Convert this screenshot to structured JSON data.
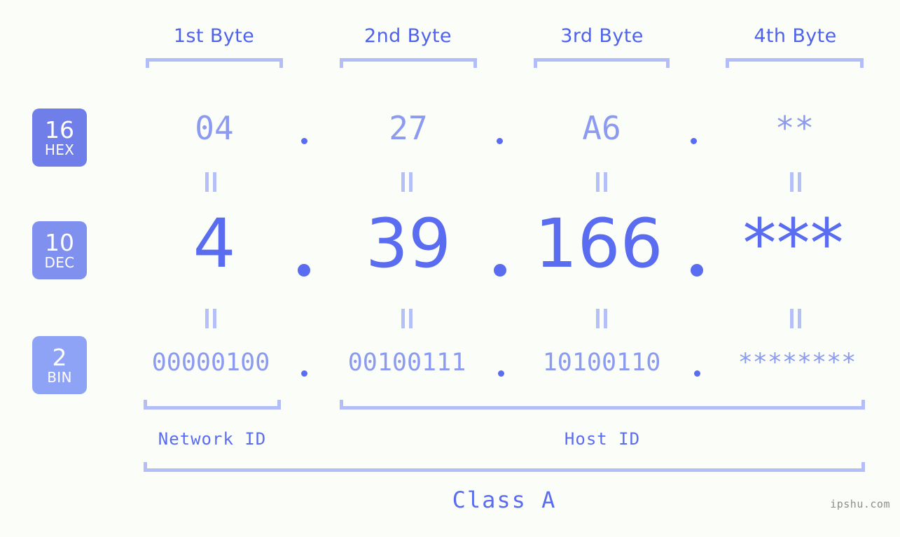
{
  "header": {
    "byte_labels": [
      "1st Byte",
      "2nd Byte",
      "3rd Byte",
      "4th Byte"
    ]
  },
  "bases": [
    {
      "number": "16",
      "name": "HEX",
      "color": "#6f7ee8"
    },
    {
      "number": "10",
      "name": "DEC",
      "color": "#8090ef"
    },
    {
      "number": "2",
      "name": "BIN",
      "color": "#8fa3f6"
    }
  ],
  "rows": {
    "hex": {
      "values": [
        "04",
        "27",
        "A6",
        "**"
      ],
      "separator": "."
    },
    "dec": {
      "values": [
        "4",
        "39",
        "166",
        "***"
      ],
      "separator": "."
    },
    "bin": {
      "values": [
        "00000100",
        "00100111",
        "10100110",
        "********"
      ],
      "separator": "."
    }
  },
  "connectors": {
    "equals_glyph": "||"
  },
  "footer": {
    "network_id_label": "Network ID",
    "host_id_label": "Host ID",
    "class_label": "Class A",
    "watermark": "ipshu.com"
  },
  "colors": {
    "background": "#fbfdf8",
    "accent_strong": "#5a6df0",
    "accent_mid": "#8c9bf0",
    "accent_light": "#b3bdf7",
    "byte_label": "#4f62ec",
    "watermark": "#8d8d8d"
  }
}
